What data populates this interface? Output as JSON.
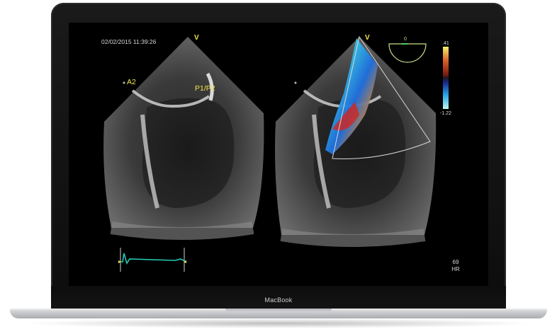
{
  "device": {
    "brand_label": "MacBook"
  },
  "viewer": {
    "timestamp": "02/02/2015 11:39:26",
    "left_panel": {
      "orientation_marker": "V",
      "labels": {
        "a2": "A2",
        "p1p2": "P1/P2"
      }
    },
    "right_panel": {
      "orientation_marker": "V",
      "color_scale": {
        "top": ".41",
        "bottom": "-1.22"
      },
      "probe_angle": "0"
    },
    "heart_rate": {
      "value": "69",
      "label": "HR"
    }
  },
  "colors": {
    "annotation_yellow": "#f0e64a",
    "ecg_trace": "#26c8b4",
    "screen_bg": "#000000"
  }
}
